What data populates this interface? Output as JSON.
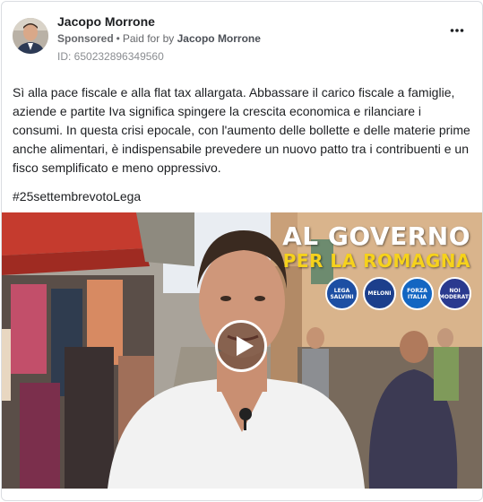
{
  "post": {
    "author": "Jacopo Morrone",
    "sponsored_label": "Sponsored",
    "paid_for_prefix": "Paid for by",
    "paid_for_by": "Jacopo Morrone",
    "library_id": "ID: 650232896349560",
    "more_icon": "more-horizontal-icon",
    "text": "Sì alla pace fiscale e alla flat tax allargata. Abbassare il carico fiscale a famiglie, aziende e partite Iva significa spingere la crescita economica e rilanciare i consumi. In questa crisi epocale, con l'aumento delle bollette e delle materie prime anche alimentari, è indispensabile prevedere un nuovo patto tra i contribuenti e un fisco semplificato e meno oppressivo.",
    "hashtag": "#25settembrevotoLega"
  },
  "video": {
    "overlay_line1": "AL GOVERNO",
    "overlay_line2": "PER LA ROMAGNA",
    "play_icon": "play-icon",
    "logos": [
      {
        "text": "LEGA SALVINI",
        "color": "#1d4fa3"
      },
      {
        "text": "MELONI",
        "color": "#1c3f8c"
      },
      {
        "text": "FORZA ITALIA",
        "color": "#1366c2"
      },
      {
        "text": "NOI MODERATI",
        "color": "#2a3a8f"
      }
    ]
  }
}
